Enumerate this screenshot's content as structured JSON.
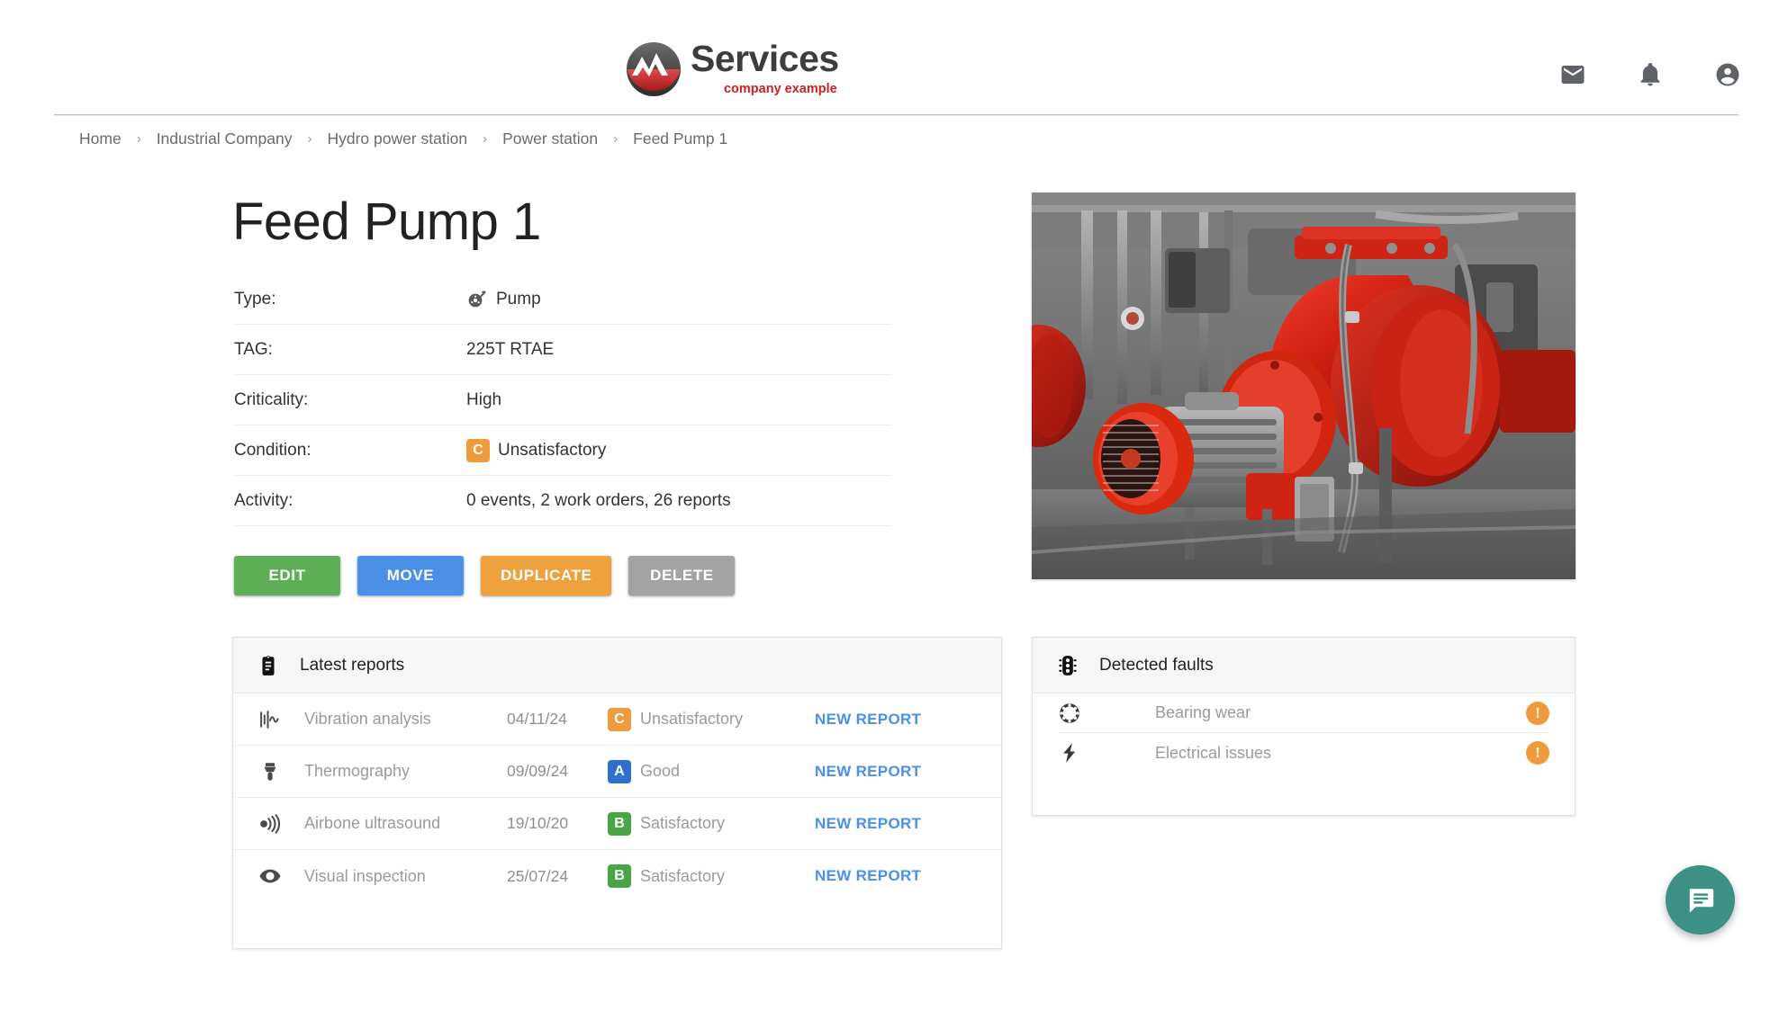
{
  "header": {
    "logo_title": "Services",
    "logo_subtitle": "company example",
    "icons": [
      {
        "name": "mail-icon",
        "label": "Mail"
      },
      {
        "name": "bell-icon",
        "label": "Notifications"
      },
      {
        "name": "account-circle-icon",
        "label": "Account"
      }
    ]
  },
  "breadcrumb": {
    "items": [
      {
        "label": "Home"
      },
      {
        "label": "Industrial Company"
      },
      {
        "label": "Hydro power station"
      },
      {
        "label": "Power station"
      },
      {
        "label": "Feed Pump 1"
      }
    ],
    "separator": "›"
  },
  "main": {
    "title": "Feed Pump 1",
    "details": [
      {
        "label": "Type:",
        "value": "Pump",
        "icon": "pump-icon"
      },
      {
        "label": "TAG:",
        "value": "225T RTAE",
        "icon": null
      },
      {
        "label": "Criticality:",
        "value": "High",
        "icon": null
      },
      {
        "label": "Condition:",
        "value": "Unsatisfactory",
        "grade": "C",
        "grade_color": "#ef9a3d"
      },
      {
        "label": "Activity:",
        "value": "0 events, 2 work orders, 26 reports",
        "icon": null
      }
    ],
    "buttons": [
      {
        "label": "EDIT",
        "color": "#5faf56",
        "name": "edit-button"
      },
      {
        "label": "MOVE",
        "color": "#4a90e8",
        "name": "move-button"
      },
      {
        "label": "DUPLICATE",
        "color": "#efa13d",
        "name": "duplicate-button"
      },
      {
        "label": "DELETE",
        "color": "#a3a3a3",
        "name": "delete-button"
      }
    ],
    "photo_alt": "Red industrial centrifugal feed pumps with electric motors in machine room"
  },
  "reports_panel": {
    "title": "Latest reports",
    "header_icon": "clipboard-icon",
    "action_label": "NEW REPORT",
    "rows": [
      {
        "icon": "vibration-waveform-icon",
        "name": "Vibration analysis",
        "date": "04/11/24",
        "grade": "C",
        "grade_color": "#ef9a3d",
        "condition": "Unsatisfactory",
        "action": "NEW REPORT"
      },
      {
        "icon": "thermal-camera-icon",
        "name": "Thermography",
        "date": "09/09/24",
        "grade": "A",
        "grade_color": "#2f6fd0",
        "condition": "Good",
        "action": "NEW REPORT"
      },
      {
        "icon": "ultrasound-icon",
        "name": "Airbone ultrasound",
        "date": "19/10/20",
        "grade": "B",
        "grade_color": "#49a546",
        "condition": "Satisfactory",
        "action": "NEW REPORT"
      },
      {
        "icon": "eye-icon",
        "name": "Visual inspection",
        "date": "25/07/24",
        "grade": "B",
        "grade_color": "#49a546",
        "condition": "Satisfactory",
        "action": "NEW REPORT"
      }
    ]
  },
  "faults_panel": {
    "title": "Detected faults",
    "header_icon": "traffic-light-icon",
    "rows": [
      {
        "icon": "ball-bearing-icon",
        "name": "Bearing wear",
        "severity": "!",
        "severity_color": "#ef9a3d"
      },
      {
        "icon": "lightning-bolt-icon",
        "name": "Electrical issues",
        "severity": "!",
        "severity_color": "#ef9a3d"
      }
    ]
  },
  "fab": {
    "name": "chat-button",
    "icon": "chat-bubble-icon",
    "color": "#3d9184"
  }
}
